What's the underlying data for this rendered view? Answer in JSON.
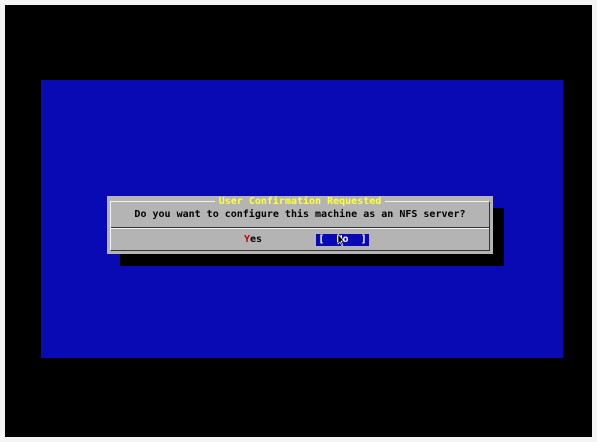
{
  "dialog": {
    "title": "User Confirmation Requested",
    "message": "Do you want to configure this machine as an NFS server?",
    "yes_button": {
      "hotkey": "Y",
      "rest": "es"
    },
    "no_button": {
      "open_bracket": "[",
      "hotkey": "N",
      "rest": "o",
      "close_bracket": "]",
      "selected": true
    }
  },
  "colors": {
    "screen_background": "#000000",
    "console_background": "#0a0ab4",
    "dialog_background": "#b4b4b4",
    "title_text": "#ffff3c",
    "hotkey_text": "#c80000",
    "selected_button_background": "#0a0ab4",
    "selected_button_text": "#ffffff"
  }
}
